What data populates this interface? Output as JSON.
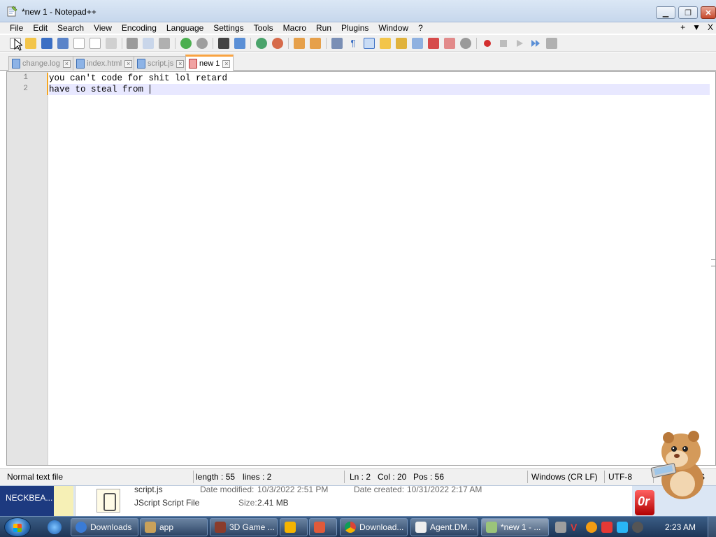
{
  "window": {
    "title": "*new 1 - Notepad++"
  },
  "menu": {
    "items": [
      "File",
      "Edit",
      "Search",
      "View",
      "Encoding",
      "Language",
      "Settings",
      "Tools",
      "Macro",
      "Run",
      "Plugins",
      "Window",
      "?"
    ],
    "right_plus": "+",
    "right_arrow": "▼",
    "right_close": "X"
  },
  "tabs": [
    {
      "label": "change.log",
      "active": false
    },
    {
      "label": "index.html",
      "active": false
    },
    {
      "label": "script.js",
      "active": false
    },
    {
      "label": "new 1",
      "active": true
    }
  ],
  "editor": {
    "lines": [
      {
        "number": "1",
        "text": "you can't code for shit lol retard"
      },
      {
        "number": "2",
        "text": "have to steal from "
      }
    ],
    "current_line_color": "#e8e8ff",
    "gutter_color": "#e4e4e4"
  },
  "status": {
    "file_type": "Normal text file",
    "length": "length : 55",
    "lines": "lines : 2",
    "ln": "Ln : 2",
    "col": "Col : 20",
    "pos": "Pos : 56",
    "eol": "Windows (CR LF)",
    "encoding": "UTF-8",
    "mode": "S"
  },
  "explorer": {
    "left_label": "NECKBEA...",
    "file_name": "script.js",
    "file_type": "JScript Script File",
    "date_modified_label": "Date modified:",
    "date_modified": "10/3/2022 2:51 PM",
    "size_label": "Size:",
    "size": "2.41 MB",
    "date_created_label": "Date created:",
    "date_created": "10/31/2022 2:17 AM"
  },
  "taskbar": {
    "buttons": [
      {
        "label": "Downloads",
        "color": "#3a7bd5"
      },
      {
        "label": "app",
        "color": "#c9a15a"
      },
      {
        "label": "3D Game ...",
        "color": "#8a3c2c"
      },
      {
        "label": "",
        "color": "#f5b400"
      },
      {
        "label": "",
        "color": "#e05a3a"
      },
      {
        "label": "Download...",
        "color": "#db4437"
      },
      {
        "label": "Agent.DM...",
        "color": "#eeeeee"
      },
      {
        "label": "*new 1 - ...",
        "color": "#9bc47a"
      }
    ],
    "clock": "2:23 AM"
  },
  "colors": {
    "accent_tab": "#f9a341",
    "titlebar": "#c6d7ec",
    "taskbar": "#1e3657"
  }
}
